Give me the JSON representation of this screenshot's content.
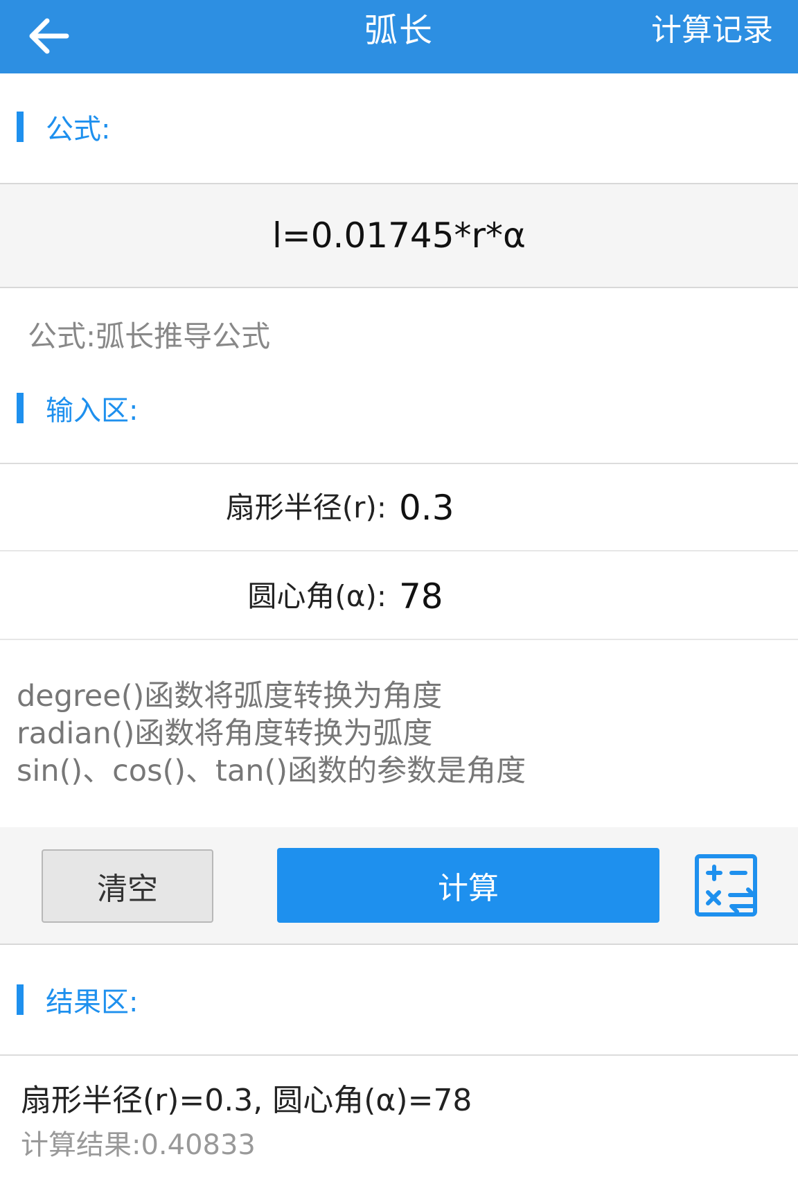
{
  "appbar": {
    "title": "弧长",
    "history_label": "计算记录",
    "back_icon": "arrow-left-icon"
  },
  "formula_section": {
    "label": "公式:",
    "formula": "l=0.01745*r*α",
    "formula_name": "公式:弧长推导公式"
  },
  "input_section": {
    "label": "输入区:",
    "fields": [
      {
        "label": "扇形半径(r):",
        "value": "0.3"
      },
      {
        "label": "圆心角(α):",
        "value": "78"
      }
    ],
    "notes": [
      "degree()函数将弧度转换为角度",
      "radian()函数将角度转换为弧度",
      "sin()、cos()、tan()函数的参数是角度"
    ]
  },
  "buttons": {
    "clear_label": "清空",
    "calculate_label": "计算",
    "calculator_icon": "calculator-icon"
  },
  "result_section": {
    "label": "结果区:",
    "summary": "扇形半径(r)=0.3, 圆心角(α)=78",
    "result": "计算结果:0.40833"
  },
  "colors": {
    "appbar": "#2d8fe2",
    "accent": "#1e90ee"
  }
}
